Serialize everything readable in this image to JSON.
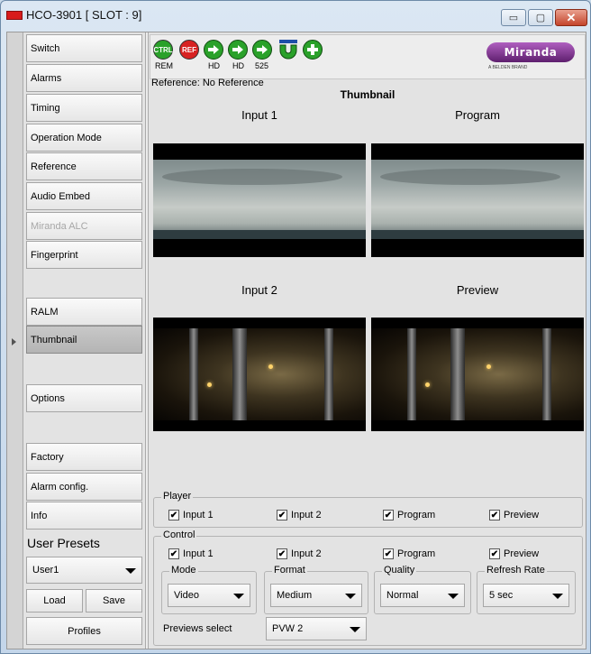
{
  "window": {
    "title": "HCO-3901 [ SLOT : 9]",
    "minimize_glyph": "▭",
    "maximize_glyph": "▢",
    "close_glyph": "✕"
  },
  "nav": {
    "items": [
      {
        "label": "Switch"
      },
      {
        "label": "Alarms"
      },
      {
        "label": "Timing"
      },
      {
        "label": "Operation Mode"
      },
      {
        "label": "Reference"
      },
      {
        "label": "Audio Embed"
      },
      {
        "label": "Miranda ALC"
      },
      {
        "label": "Fingerprint"
      },
      {
        "label": "RALM"
      },
      {
        "label": "Thumbnail"
      },
      {
        "label": "Options"
      },
      {
        "label": "Factory"
      },
      {
        "label": "Alarm config."
      },
      {
        "label": "Info"
      }
    ],
    "presets_label": "User Presets",
    "preset_value": "User1",
    "load_label": "Load",
    "save_label": "Save",
    "profiles_label": "Profiles"
  },
  "toolbar": {
    "ctrl_label": "CTRL",
    "ctrl_sub": "REM",
    "ref_label": "REF",
    "arrow_subs": [
      "HD",
      "HD",
      "525"
    ],
    "logo_text": "Miranda",
    "logo_sub": "A BELDEN BRAND"
  },
  "reference_text": "Reference: No Reference",
  "panel": {
    "title": "Thumbnail",
    "thumbs": {
      "input1": "Input 1",
      "program": "Program",
      "input2": "Input 2",
      "preview": "Preview"
    }
  },
  "player": {
    "legend": "Player",
    "checks": [
      "Input 1",
      "Input 2",
      "Program",
      "Preview"
    ],
    "check_mark": "✔"
  },
  "control": {
    "legend": "Control",
    "checks": [
      "Input 1",
      "Input 2",
      "Program",
      "Preview"
    ],
    "mode_label": "Mode",
    "mode_value": "Video",
    "format_label": "Format",
    "format_value": "Medium",
    "quality_label": "Quality",
    "quality_value": "Normal",
    "refresh_label": "Refresh Rate",
    "refresh_value": "5 sec",
    "previews_label": "Previews select",
    "previews_value": "PVW 2"
  }
}
